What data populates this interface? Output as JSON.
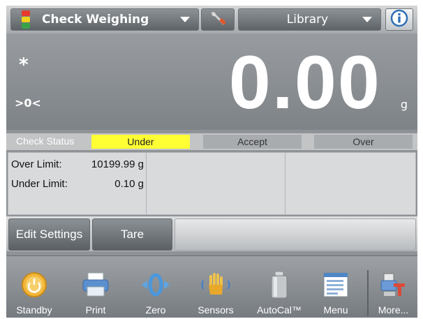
{
  "header": {
    "app_name": "Check Weighing",
    "library_label": "Library",
    "app_icon": "check-weighing-light-icon",
    "tools_icon": "wrench-icon",
    "info_icon": "info-icon"
  },
  "display": {
    "stable_indicator": "*",
    "zero_indicator": ">0<",
    "weight": "0.00",
    "unit": "g"
  },
  "check_status": {
    "label": "Check Status",
    "under": "Under",
    "accept": "Accept",
    "over": "Over",
    "active": "Under",
    "active_color": "#ffff33"
  },
  "limits": {
    "over_label": "Over Limit:",
    "over_value": "10199.99 g",
    "under_label": "Under Limit:",
    "under_value": "0.10 g"
  },
  "actions": {
    "edit_settings": "Edit Settings",
    "tare": "Tare"
  },
  "nav": {
    "items": [
      {
        "label": "Standby",
        "icon": "standby-icon"
      },
      {
        "label": "Print",
        "icon": "printer-icon"
      },
      {
        "label": "Zero",
        "icon": "zero-icon"
      },
      {
        "label": "Sensors",
        "icon": "hand-sensor-icon"
      },
      {
        "label": "AutoCal™",
        "icon": "calibration-weight-icon"
      },
      {
        "label": "Menu",
        "icon": "menu-list-icon"
      },
      {
        "label": "More...",
        "icon": "more-icon"
      }
    ]
  }
}
